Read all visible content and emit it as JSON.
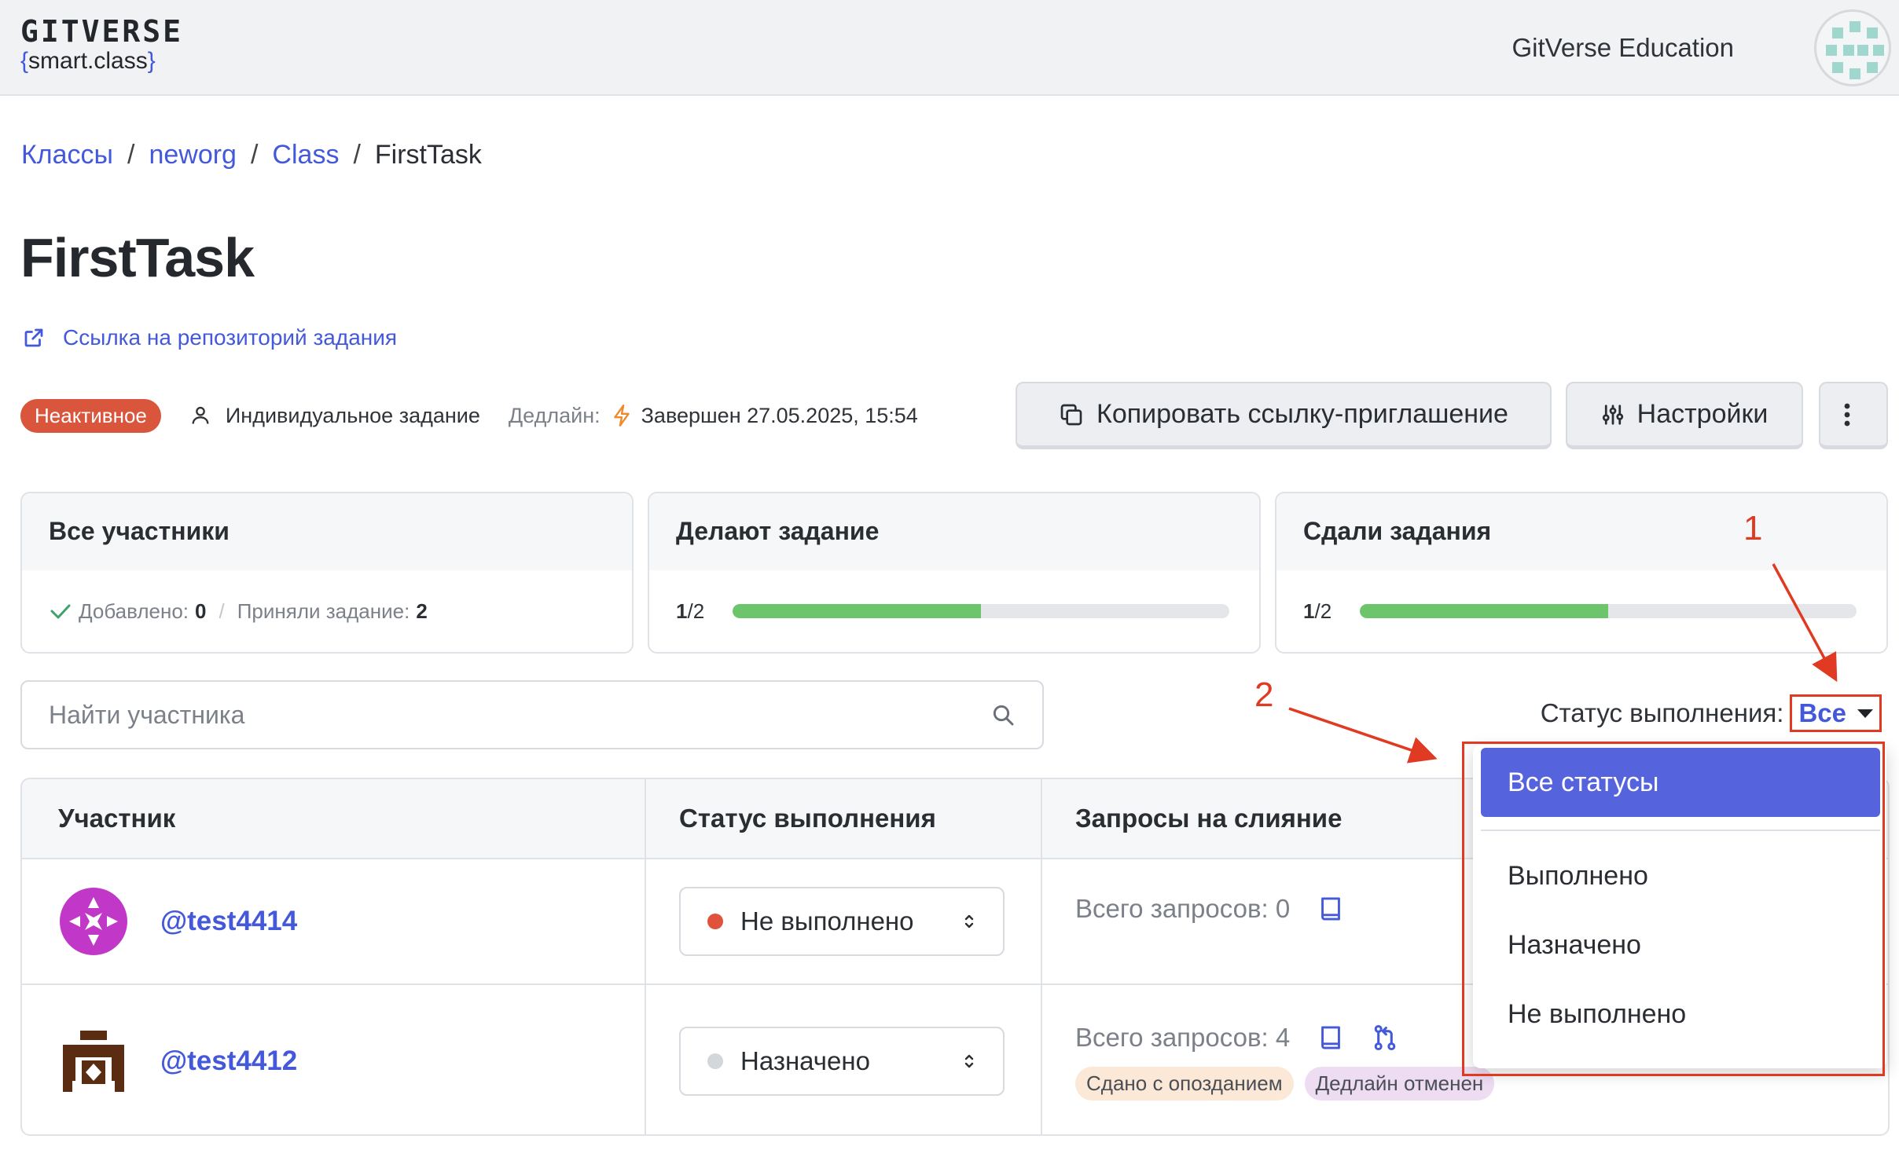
{
  "header": {
    "logo_main": "GITVERSE",
    "logo_sub_open": "{",
    "logo_sub_text": "smart.class",
    "logo_sub_close": "}",
    "org_name": "GitVerse Education"
  },
  "breadcrumb": {
    "items": [
      "Классы",
      "neworg",
      "Class"
    ],
    "current": "FirstTask",
    "separator": "/"
  },
  "page": {
    "title": "FirstTask",
    "repo_link": "Ссылка на репозиторий задания"
  },
  "meta": {
    "status_badge": "Неактивное",
    "task_type": "Индивидуальное задание",
    "deadline_label": "Дедлайн:",
    "deadline_value": "Завершен 27.05.2025, 15:54"
  },
  "actions": {
    "copy_invite": "Копировать ссылку-приглашение",
    "settings": "Настройки"
  },
  "stats": {
    "all": {
      "title": "Все участники",
      "added_label": "Добавлено:",
      "added_value": "0",
      "accepted_label": "Приняли задание:",
      "accepted_value": "2"
    },
    "doing": {
      "title": "Делают задание",
      "count": "1",
      "total": "/2",
      "progress": 0.5
    },
    "submitted": {
      "title": "Сдали задания",
      "count": "1",
      "total": "/2",
      "progress": 0.5
    }
  },
  "search": {
    "placeholder": "Найти участника"
  },
  "filter": {
    "label": "Статус выполнения:",
    "value": "Все",
    "options": [
      "Все статусы",
      "Выполнено",
      "Назначено",
      "Не выполнено"
    ]
  },
  "table": {
    "headers": [
      "Участник",
      "Статус выполнения",
      "Запросы на слияние"
    ],
    "rows": [
      {
        "user": "@test4414",
        "status": "Не выполнено",
        "status_color": "#e0523a",
        "pr_label": "Всего запросов: 0",
        "tags": []
      },
      {
        "user": "@test4412",
        "status": "Назначено",
        "status_color": "#d3d6da",
        "pr_label": "Всего запросов: 4",
        "tags": [
          "Сдано с опозданием",
          "Дедлайн отменен"
        ]
      }
    ]
  },
  "annotations": [
    "1",
    "2"
  ],
  "colors": {
    "accent": "#4459d9",
    "badge_inactive": "#d9553b",
    "progress": "#6cc56b",
    "annotation": "#e03a22",
    "dropdown_active": "#5563dc"
  }
}
